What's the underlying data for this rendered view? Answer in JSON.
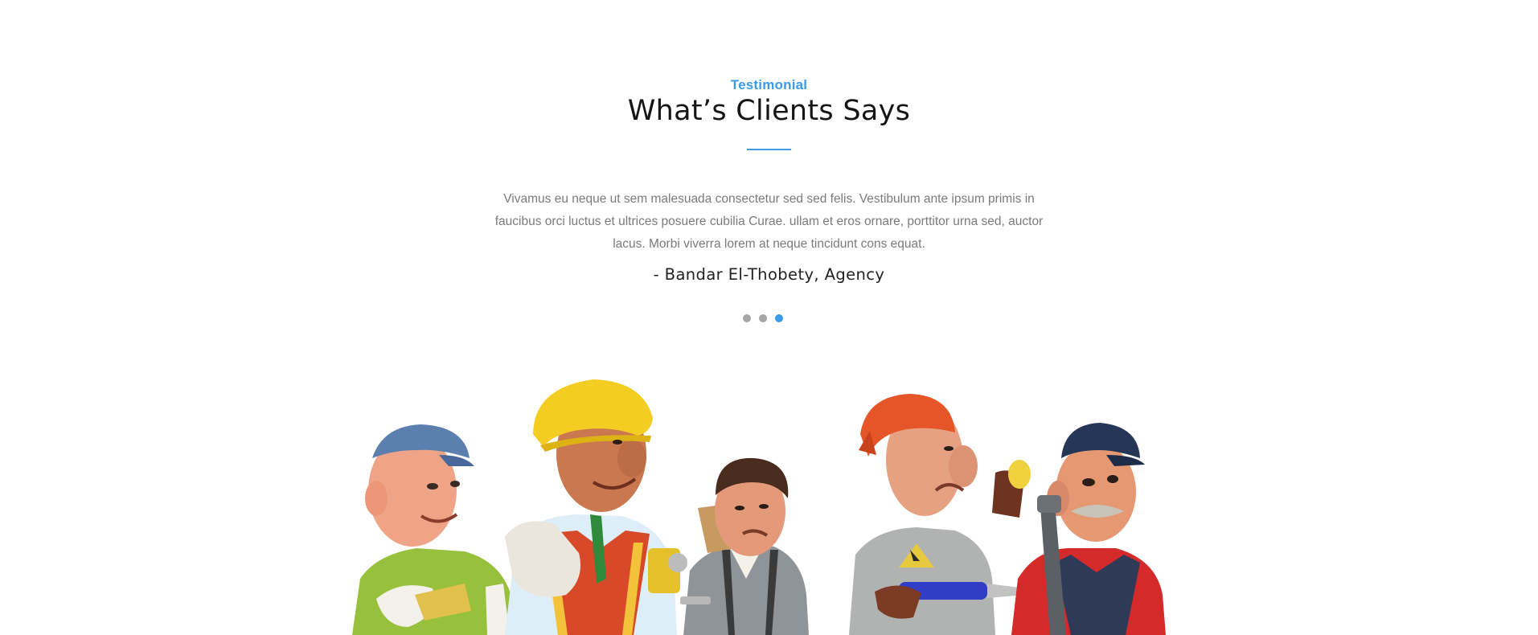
{
  "testimonial": {
    "eyebrow": "Testimonial",
    "title": "What’s Clients Says",
    "quote": "Vivamus eu neque ut sem malesuada consectetur sed sed felis. Vestibulum ante ipsum primis in faucibus orci luctus et ultrices posuere cubilia Curae. ullam et eros ornare, porttitor urna sed, auctor lacus. Morbi viverra lorem at neque tincidunt cons equat.",
    "author": "- Bandar El-Thobety, Agency",
    "slides": {
      "count": 3,
      "active_index": 2
    }
  },
  "colors": {
    "accent": "#3b9be6",
    "dot_inactive": "#a5a5a5",
    "text_dark": "#151515",
    "text_muted": "#7b7b7b"
  },
  "image": {
    "subject": "figurines-of-five-workmen",
    "icon": "workers-illustration"
  }
}
